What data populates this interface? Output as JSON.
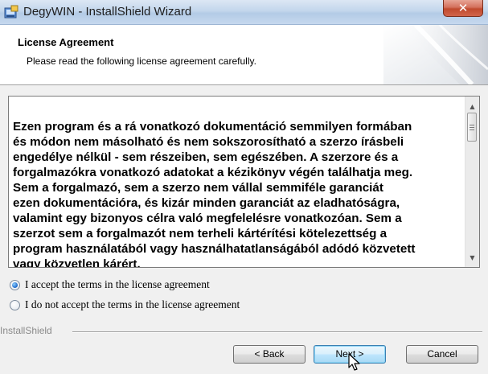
{
  "window": {
    "title": "DegyWIN - InstallShield Wizard",
    "close_glyph": "✕",
    "app_icon": "installer-icon"
  },
  "header": {
    "title": "License Agreement",
    "subtitle": "Please read the following license agreement carefully."
  },
  "license": {
    "lines": [
      "Ezen program és a rá vonatkozó dokumentáció semmilyen formában",
      "és módon nem másolható és nem sokszorosítható a szerzo írásbeli",
      "engedélye nélkül - sem részeiben, sem egészében. A szerzore és a",
      "forgalmazókra vonatkozó adatokat a kézikönyv végén találhatja meg.",
      "Sem a forgalmazó, sem a szerzo nem vállal semmiféle garanciát",
      "ezen dokumentációra, és kizár minden garanciát az eladhatóságra,",
      "valamint egy bizonyos célra való megfelelésre vonatkozóan. Sem a",
      "szerzot sem a forgalmazót nem terheli kártérítési kötelezettség a",
      "program használatából vagy használhatatlanságából adódó közvetett",
      "vagy közvetlen kárért."
    ],
    "scroll_up_glyph": "▲",
    "scroll_down_glyph": "▼"
  },
  "options": {
    "accept_label": "I accept the terms in the license agreement",
    "decline_label": "I do not accept the terms in the license agreement",
    "selected": "accept"
  },
  "footer": {
    "brand": "InstallShield",
    "back_label": "< Back",
    "next_label": "Next >",
    "cancel_label": "Cancel"
  },
  "colors": {
    "title_bar": "#c3d6ec",
    "close_button": "#c04a2e",
    "default_button_border": "#3c7fb1"
  }
}
